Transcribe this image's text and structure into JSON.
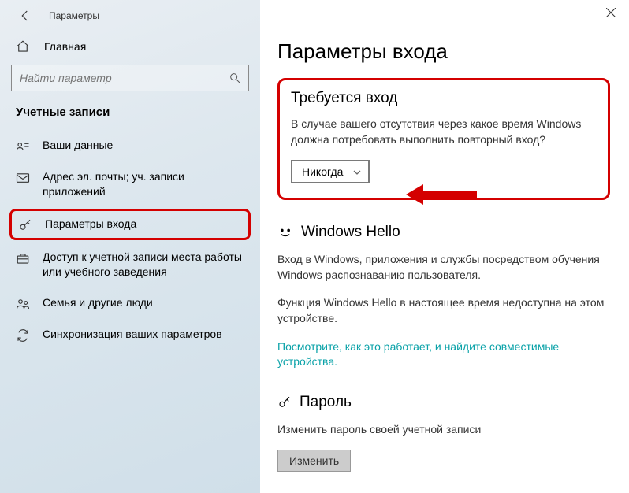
{
  "titlebar": {
    "title": "Параметры"
  },
  "home": {
    "label": "Главная"
  },
  "search": {
    "placeholder": "Найти параметр"
  },
  "section_title": "Учетные записи",
  "nav": {
    "your_info": "Ваши данные",
    "email": "Адрес эл. почты; уч. записи приложений",
    "signin": "Параметры входа",
    "work": "Доступ к учетной записи места работы или учебного заведения",
    "family": "Семья и другие люди",
    "sync": "Синхронизация ваших параметров"
  },
  "page": {
    "title": "Параметры входа"
  },
  "require": {
    "heading": "Требуется вход",
    "desc": "В случае вашего отсутствия через какое время Windows должна потребовать выполнить повторный вход?",
    "value": "Никогда"
  },
  "hello": {
    "heading": "Windows Hello",
    "desc1": "Вход в Windows, приложения и службы посредством обучения Windows распознаванию пользователя.",
    "desc2": "Функция Windows Hello в настоящее время недоступна на этом устройстве.",
    "link": "Посмотрите, как это работает, и найдите совместимые устройства."
  },
  "password": {
    "heading": "Пароль",
    "desc": "Изменить пароль своей учетной записи",
    "button": "Изменить"
  }
}
